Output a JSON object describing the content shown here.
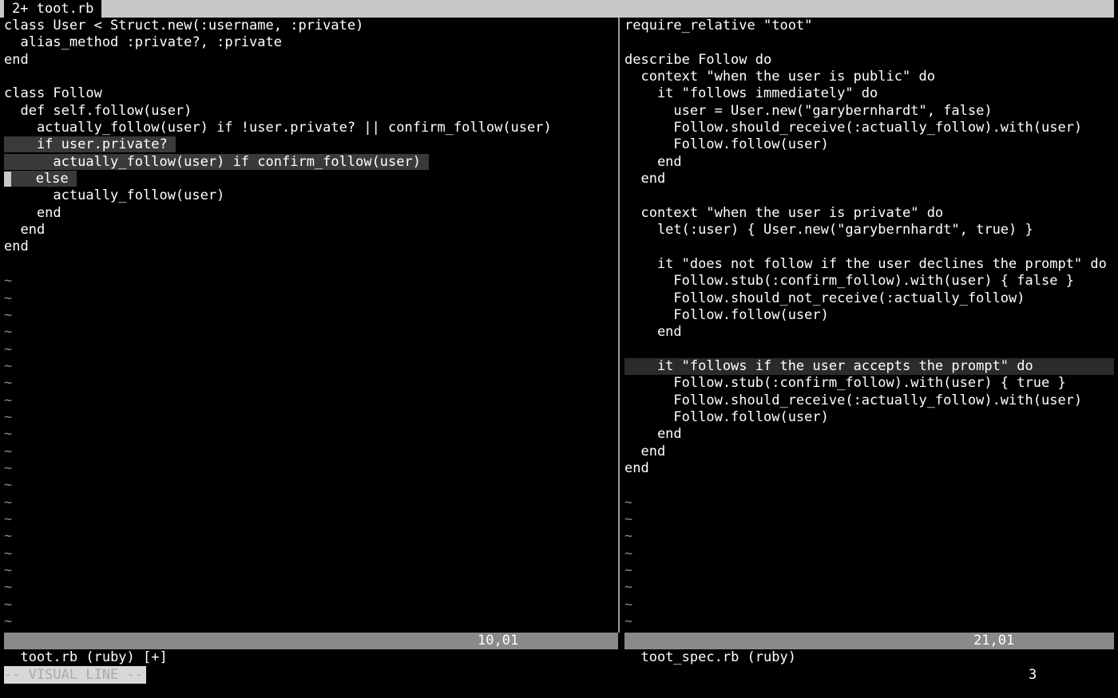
{
  "tabline": {
    "active_tab": "2+ toot.rb"
  },
  "left_pane": {
    "lines": [
      "class User < Struct.new(:username, :private)",
      "  alias_method :private?, :private",
      "end",
      "",
      "class Follow",
      "  def self.follow(user)",
      "    actually_follow(user) if !user.private? || confirm_follow(user)",
      "    if user.private?",
      "      actually_follow(user) if confirm_follow(user)",
      "    else",
      "      actually_follow(user)",
      "    end",
      "  end",
      "end",
      "",
      "~",
      "~",
      "~",
      "~",
      "~",
      "~",
      "~",
      "~",
      "~",
      "~",
      "~",
      "~",
      "~",
      "~",
      "~",
      "~",
      "~",
      "~",
      "~",
      "~",
      "~",
      "~"
    ]
  },
  "right_pane": {
    "lines": [
      "require_relative \"toot\"",
      "",
      "describe Follow do",
      "  context \"when the user is public\" do",
      "    it \"follows immediately\" do",
      "      user = User.new(\"garybernhardt\", false)",
      "      Follow.should_receive(:actually_follow).with(user)",
      "      Follow.follow(user)",
      "    end",
      "  end",
      "",
      "  context \"when the user is private\" do",
      "    let(:user) { User.new(\"garybernhardt\", true) }",
      "",
      "    it \"does not follow if the user declines the prompt\" do",
      "      Follow.stub(:confirm_follow).with(user) { false }",
      "      Follow.should_not_receive(:actually_follow)",
      "      Follow.follow(user)",
      "    end",
      "",
      "    it \"follows if the user accepts the prompt\" do",
      "      Follow.stub(:confirm_follow).with(user) { true }",
      "      Follow.should_receive(:actually_follow).with(user)",
      "      Follow.follow(user)",
      "    end",
      "  end",
      "end",
      "",
      "~",
      "~",
      "~",
      "~",
      "~",
      "~",
      "~",
      "~"
    ]
  },
  "status": {
    "left_file": "toot.rb (ruby) [+]",
    "left_pos": "10,01",
    "right_file": "toot_spec.rb (ruby)",
    "right_pos": "21,01"
  },
  "cmdline": {
    "mode": "-- VISUAL LINE --",
    "count": "3"
  }
}
